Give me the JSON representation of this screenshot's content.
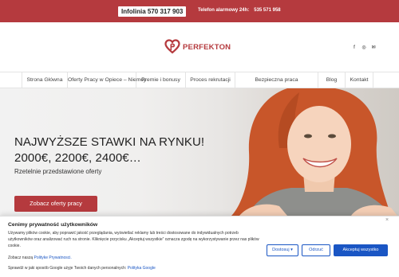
{
  "topbar": {
    "hotline": "Infolinia 570 317 903",
    "alarm_label": "Telefon alarmowy 24h:",
    "alarm_number": "535 571 958"
  },
  "header": {
    "logo_text": "PERFEKTON",
    "social_icons": [
      "facebook-icon",
      "instagram-icon",
      "email-icon"
    ]
  },
  "nav": {
    "items": [
      {
        "label": "Strona Główna"
      },
      {
        "label": "Oferty Pracy w Opiece – Niemcy"
      },
      {
        "label": "Premie i bonusy"
      },
      {
        "label": "Proces rekrutacji"
      },
      {
        "label": "Bezpieczna praca"
      },
      {
        "label": "Blog"
      },
      {
        "label": "Kontakt"
      }
    ]
  },
  "hero": {
    "title": "NAJWYŻSZE STAWKI NA RYNKU! 2000€, 2200€, 2400€…",
    "subtitle": "Rzetelnie przedstawione oferty",
    "button": "Zobacz oferty pracy"
  },
  "cookie": {
    "title": "Cenimy prywatność użytkowników",
    "body": "Używamy plików cookie, aby poprawić jakość przeglądania, wyświetlać reklamy lub treści dostosowane do indywidualnych potrzeb użytkowników oraz analizować ruch na stronie. Kliknięcie przycisku „Akceptuj wszystkie” oznacza zgodę na wykorzystywanie przez nas plików cookie.",
    "policy_prefix": "Zobacz naszą",
    "policy_link": "Polityke Prywatnosci.",
    "google_prefix": "Sprawdź w jaki sposób Google użyje Twoich danych  personalnych:",
    "google_link": "Polityka Google",
    "customize": "Dostosuj",
    "reject": "Odrzuć",
    "accept": "Akceptuj wszystko",
    "close": "×"
  },
  "colors": {
    "brand": "#b53a3e",
    "cookie_accent": "#1a56c4"
  }
}
